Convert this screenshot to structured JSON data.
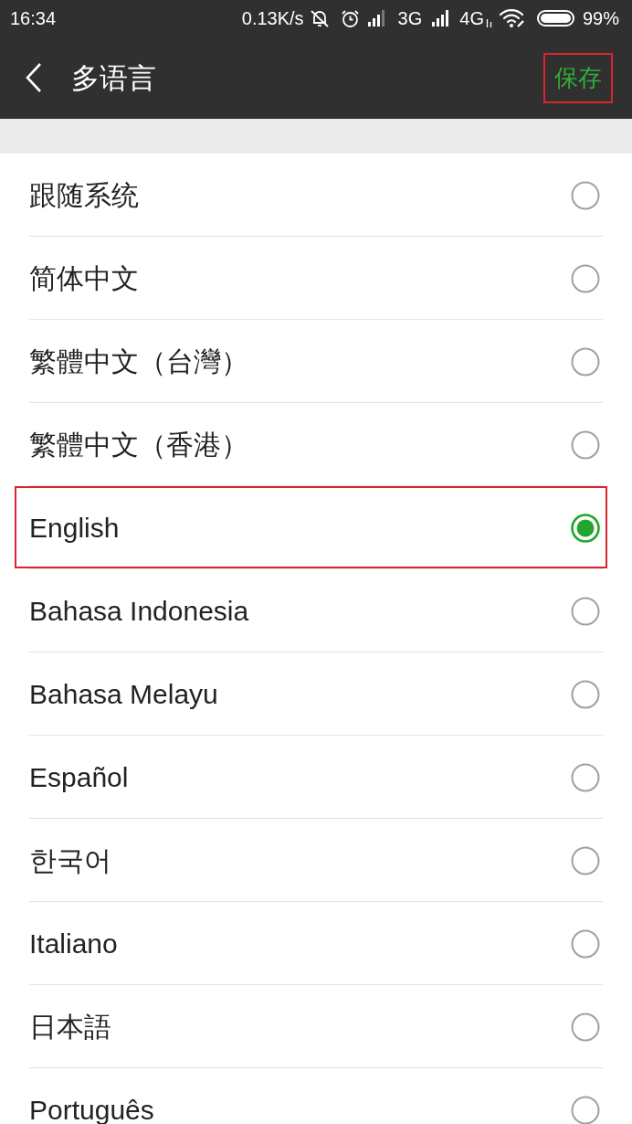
{
  "status_bar": {
    "time": "16:34",
    "network_speed": "0.13K/s",
    "network_1": "3G",
    "network_2": "4G",
    "battery": "99%"
  },
  "header": {
    "title": "多语言",
    "save_button": {
      "label": "保存",
      "highlighted": true
    }
  },
  "languages": [
    {
      "label": "跟随系统",
      "selected": false,
      "highlighted": false
    },
    {
      "label": "简体中文",
      "selected": false,
      "highlighted": false
    },
    {
      "label": "繁體中文（台灣）",
      "selected": false,
      "highlighted": false
    },
    {
      "label": "繁體中文（香港）",
      "selected": false,
      "highlighted": false
    },
    {
      "label": "English",
      "selected": true,
      "highlighted": true
    },
    {
      "label": "Bahasa Indonesia",
      "selected": false,
      "highlighted": false
    },
    {
      "label": "Bahasa Melayu",
      "selected": false,
      "highlighted": false
    },
    {
      "label": "Español",
      "selected": false,
      "highlighted": false
    },
    {
      "label": "한국어",
      "selected": false,
      "highlighted": false
    },
    {
      "label": "Italiano",
      "selected": false,
      "highlighted": false
    },
    {
      "label": "日本語",
      "selected": false,
      "highlighted": false
    },
    {
      "label": "Português",
      "selected": false,
      "highlighted": false
    }
  ]
}
